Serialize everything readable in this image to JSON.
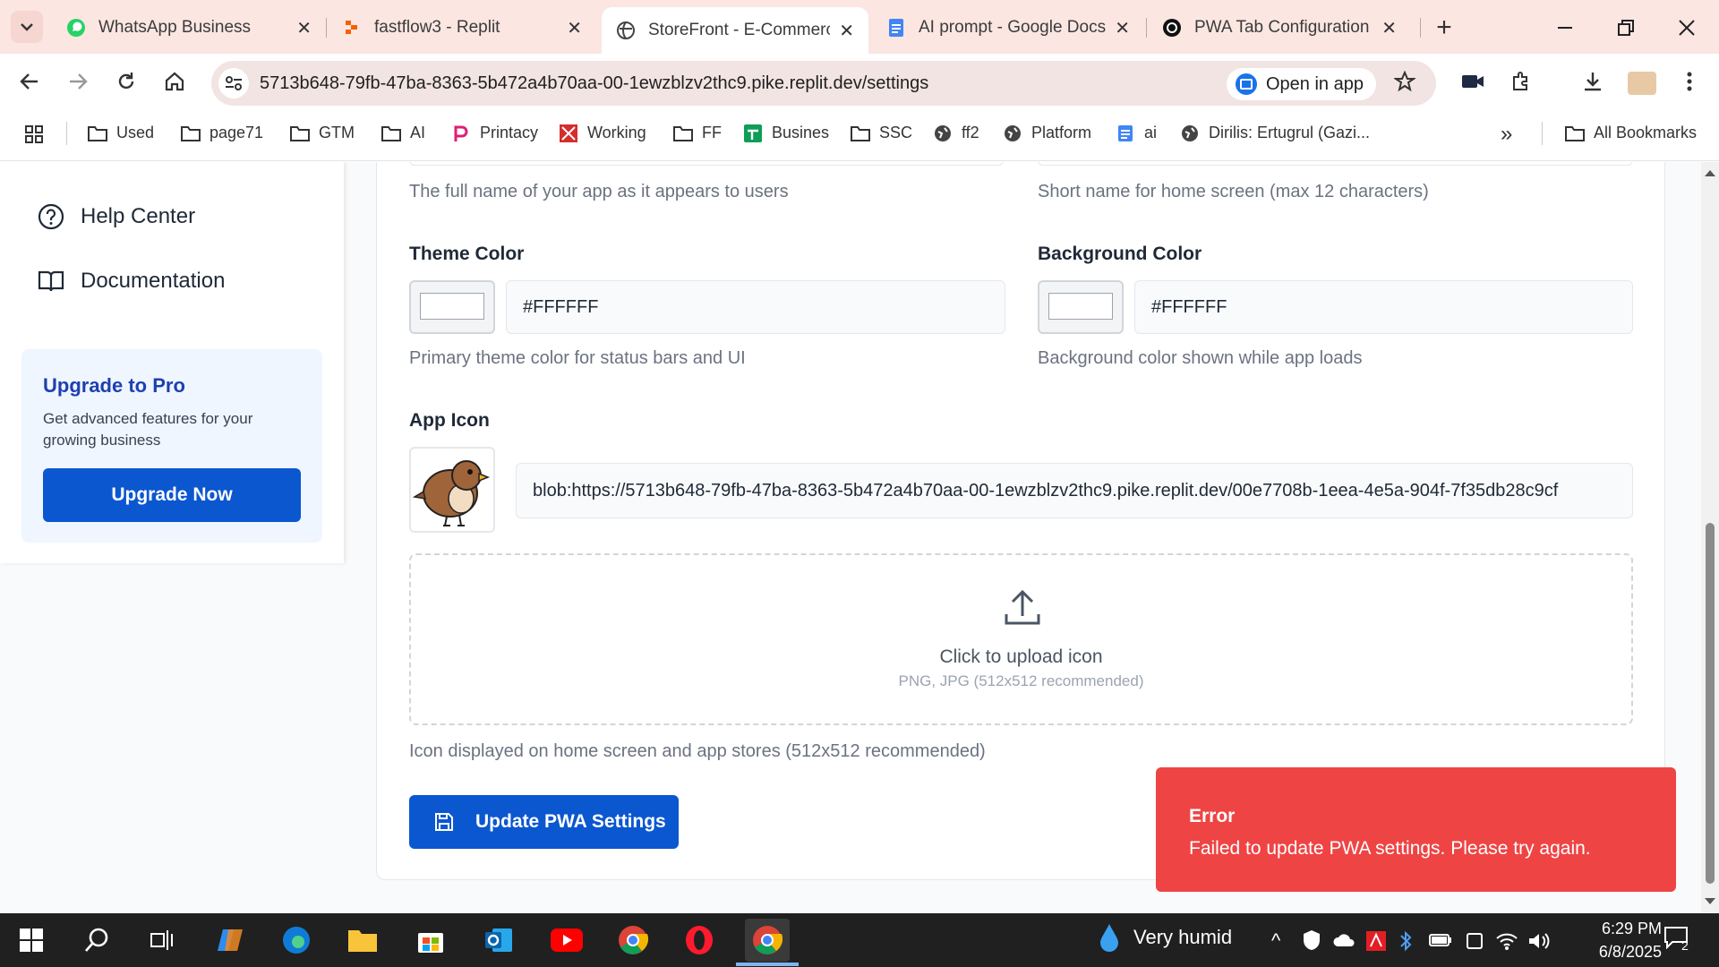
{
  "browser": {
    "tabs": [
      {
        "title": "WhatsApp Business",
        "icon": "whatsapp-icon"
      },
      {
        "title": "fastflow3 - Replit",
        "icon": "replit-icon"
      },
      {
        "title": "StoreFront - E-Commerce",
        "icon": "globe-icon",
        "active": true
      },
      {
        "title": "AI prompt - Google Docs",
        "icon": "docs-icon"
      },
      {
        "title": "PWA Tab Configuration",
        "icon": "openai-icon"
      }
    ],
    "url": "5713b648-79fb-47ba-8363-5b472a4b70aa-00-1ewzblzv2thc9.pike.replit.dev/settings",
    "open_in_app": "Open in app",
    "bookmarks": [
      "Used",
      "page71",
      "GTM",
      "AI",
      "Printacy",
      "Working",
      "FF",
      "Busines",
      "SSC",
      "ff2",
      "Platform",
      "ai",
      "Dirilis: Ertugrul (Gazi..."
    ],
    "all_bookmarks": "All Bookmarks"
  },
  "sidebar": {
    "links": [
      {
        "label": "Help Center",
        "icon": "help-circle-icon"
      },
      {
        "label": "Documentation",
        "icon": "book-icon"
      }
    ],
    "promo": {
      "title": "Upgrade to Pro",
      "description": "Get advanced features for your growing business",
      "button": "Upgrade Now"
    }
  },
  "form": {
    "app_name_help": "The full name of your app as it appears to users",
    "short_name_help": "Short name for home screen (max 12 characters)",
    "theme_color": {
      "label": "Theme Color",
      "value": "#FFFFFF",
      "help": "Primary theme color for status bars and UI"
    },
    "background_color": {
      "label": "Background Color",
      "value": "#FFFFFF",
      "help": "Background color shown while app loads"
    },
    "app_icon": {
      "label": "App Icon",
      "url": "blob:https://5713b648-79fb-47ba-8363-5b472a4b70aa-00-1ewzblzv2thc9.pike.replit.dev/00e7708b-1eea-4e5a-904f-7f35db28c9cf",
      "upload_title": "Click to upload icon",
      "upload_sub": "PNG, JPG (512x512 recommended)",
      "help": "Icon displayed on home screen and app stores (512x512 recommended)"
    },
    "submit": "Update PWA Settings"
  },
  "toast": {
    "title": "Error",
    "message": "Failed to update PWA settings. Please try again.",
    "color": "#ef4444"
  },
  "taskbar": {
    "weather": "Very humid",
    "time": "6:29 PM",
    "date": "6/8/2025",
    "notifications": "2"
  }
}
